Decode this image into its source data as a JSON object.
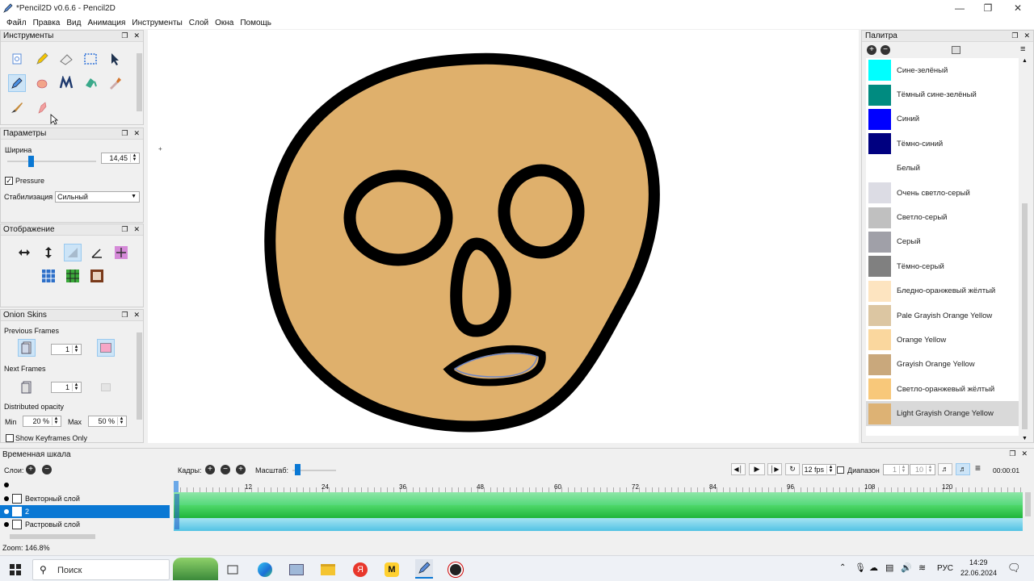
{
  "window": {
    "title": "*Pencil2D v0.6.6 - Pencil2D"
  },
  "menu": [
    "Файл",
    "Правка",
    "Вид",
    "Анимация",
    "Инструменты",
    "Слой",
    "Окна",
    "Помощь"
  ],
  "panels": {
    "tools": "Инструменты",
    "options": "Параметры",
    "display": "Отображение",
    "onion": "Onion Skins",
    "palette": "Палитра",
    "timeline": "Временная шкала"
  },
  "options": {
    "width_label": "Ширина",
    "width_value": "14,45",
    "pressure_label": "Pressure",
    "stabilization_label": "Стабилизация",
    "stabilization_value": "Сильный"
  },
  "onion": {
    "prev_label": "Previous Frames",
    "prev_value": "1",
    "next_label": "Next Frames",
    "next_value": "1",
    "dist_label": "Distributed opacity",
    "min_label": "Min",
    "min_value": "20 %",
    "max_label": "Max",
    "max_value": "50 %",
    "keyframes_label": "Show Keyframes Only"
  },
  "palette": [
    {
      "name": "Сине-зелёный",
      "color": "#00ffff"
    },
    {
      "name": "Тёмный сине-зелёный",
      "color": "#008b80"
    },
    {
      "name": "Синий",
      "color": "#0000ff"
    },
    {
      "name": "Тёмно-синий",
      "color": "#000080"
    },
    {
      "name": "Белый",
      "color": "#ffffff"
    },
    {
      "name": "Очень светло-серый",
      "color": "#dcdce4"
    },
    {
      "name": "Светло-серый",
      "color": "#c0c0c0"
    },
    {
      "name": "Серый",
      "color": "#a0a0a8"
    },
    {
      "name": "Тёмно-серый",
      "color": "#808080"
    },
    {
      "name": "Бледно-оранжевый жёлтый",
      "color": "#fde4c0"
    },
    {
      "name": "Pale Grayish Orange Yellow",
      "color": "#dcc6a2"
    },
    {
      "name": "Orange Yellow",
      "color": "#fad79e"
    },
    {
      "name": "Grayish Orange Yellow",
      "color": "#c9a87c"
    },
    {
      "name": "Светло-оранжевый жёлтый",
      "color": "#f8c87a"
    },
    {
      "name": "Light Grayish Orange Yellow",
      "color": "#ddb274",
      "selected": true
    }
  ],
  "timeline": {
    "layers_label": "Слои:",
    "frames_label": "Кадры:",
    "scale_label": "Масштаб:",
    "fps": "12 fps",
    "range_label": "Диапазон",
    "range_start": "1",
    "range_end": "10",
    "time": "00:00:01",
    "ticks": [
      "12",
      "24",
      "36",
      "48",
      "60",
      "72",
      "84",
      "96",
      "108",
      "120"
    ],
    "layers": [
      {
        "name": "Векторный слой",
        "color": "#55d97a",
        "selected": false
      },
      {
        "name": "2",
        "color": "#2ecc40",
        "selected": true
      },
      {
        "name": "Растровый слой",
        "color": "#6fcfe8",
        "selected": false
      }
    ]
  },
  "status": {
    "zoom": "Zoom: 146.8%"
  },
  "taskbar": {
    "search": "Поиск",
    "lang": "РУС",
    "time": "14:29",
    "date": "22.06.2024"
  },
  "colors": {
    "skin": "#dfb06c",
    "outline": "#000000",
    "accent": "#0a78d4"
  }
}
